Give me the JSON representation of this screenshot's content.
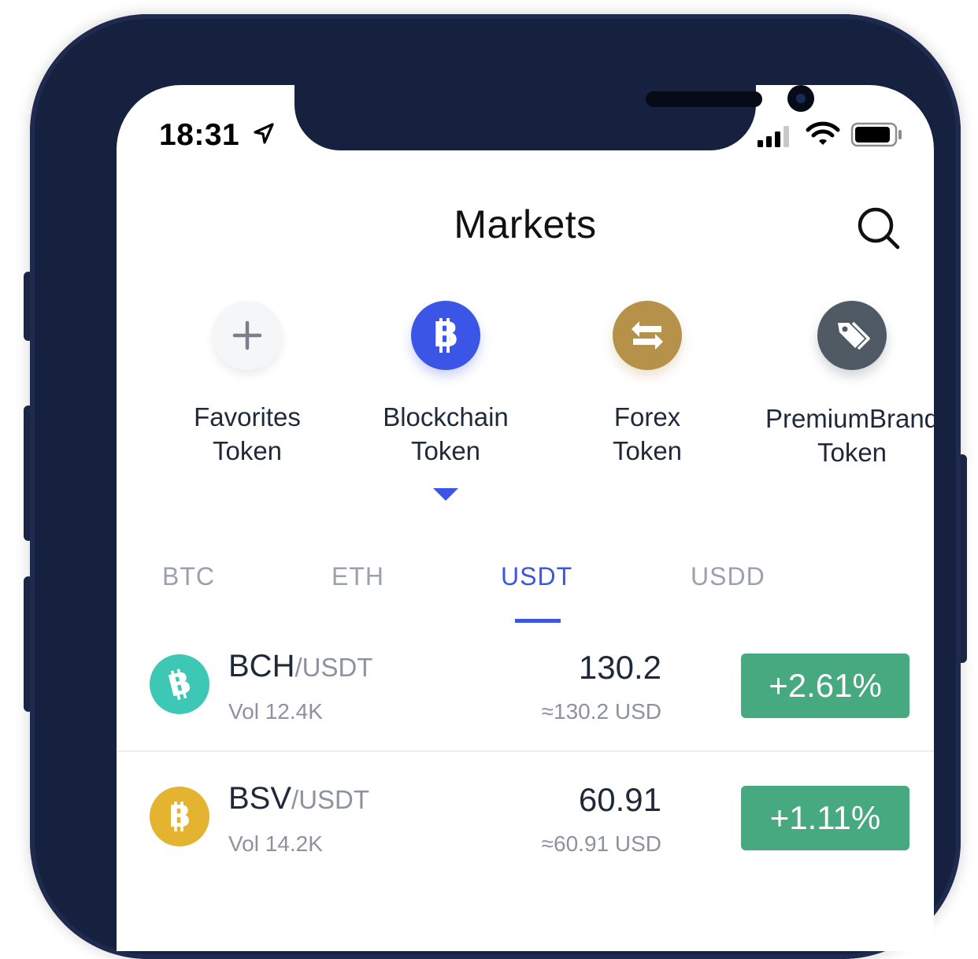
{
  "status_bar": {
    "time": "18:31"
  },
  "header": {
    "title": "Markets"
  },
  "categories": [
    {
      "line1": "Favorites",
      "line2": "Token",
      "icon": "plus-icon",
      "color": "#f5f6f8"
    },
    {
      "line1": "Blockchain",
      "line2": "Token",
      "icon": "bitcoin-icon",
      "color": "#3b55e6"
    },
    {
      "line1": "Forex",
      "line2": "Token",
      "icon": "exchange-arrows-icon",
      "color": "#b6914a"
    },
    {
      "line1": "PremiumBrand",
      "line2": "Token",
      "icon": "tag-icon",
      "color": "#4f5a65"
    }
  ],
  "quote_tabs": [
    "BTC",
    "ETH",
    "USDT",
    "USDD"
  ],
  "active_quote_tab": "USDT",
  "markets": [
    {
      "base": "BCH",
      "quote": "/USDT",
      "volume": "Vol 12.4K",
      "price": "130.2",
      "approx": "≈130.2 USD",
      "change": "+2.61%",
      "coin_color": "#3cc8b4"
    },
    {
      "base": "BSV",
      "quote": "/USDT",
      "volume": "Vol 14.2K",
      "price": "60.91",
      "approx": "≈60.91 USD",
      "change": "+1.11%",
      "coin_color": "#e4b32f"
    }
  ],
  "colors": {
    "accent": "#3b55e6",
    "positive": "#46a97f",
    "frame": "#16203f"
  }
}
